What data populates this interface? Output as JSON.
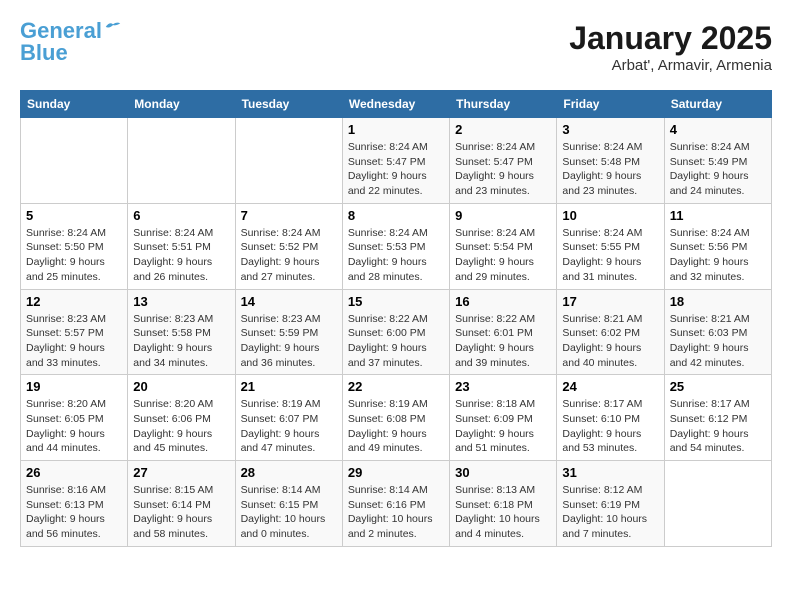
{
  "logo": {
    "line1": "General",
    "line2": "Blue"
  },
  "title": "January 2025",
  "subtitle": "Arbat', Armavir, Armenia",
  "weekdays": [
    "Sunday",
    "Monday",
    "Tuesday",
    "Wednesday",
    "Thursday",
    "Friday",
    "Saturday"
  ],
  "weeks": [
    [
      {
        "day": "",
        "info": ""
      },
      {
        "day": "",
        "info": ""
      },
      {
        "day": "",
        "info": ""
      },
      {
        "day": "1",
        "info": "Sunrise: 8:24 AM\nSunset: 5:47 PM\nDaylight: 9 hours\nand 22 minutes."
      },
      {
        "day": "2",
        "info": "Sunrise: 8:24 AM\nSunset: 5:47 PM\nDaylight: 9 hours\nand 23 minutes."
      },
      {
        "day": "3",
        "info": "Sunrise: 8:24 AM\nSunset: 5:48 PM\nDaylight: 9 hours\nand 23 minutes."
      },
      {
        "day": "4",
        "info": "Sunrise: 8:24 AM\nSunset: 5:49 PM\nDaylight: 9 hours\nand 24 minutes."
      }
    ],
    [
      {
        "day": "5",
        "info": "Sunrise: 8:24 AM\nSunset: 5:50 PM\nDaylight: 9 hours\nand 25 minutes."
      },
      {
        "day": "6",
        "info": "Sunrise: 8:24 AM\nSunset: 5:51 PM\nDaylight: 9 hours\nand 26 minutes."
      },
      {
        "day": "7",
        "info": "Sunrise: 8:24 AM\nSunset: 5:52 PM\nDaylight: 9 hours\nand 27 minutes."
      },
      {
        "day": "8",
        "info": "Sunrise: 8:24 AM\nSunset: 5:53 PM\nDaylight: 9 hours\nand 28 minutes."
      },
      {
        "day": "9",
        "info": "Sunrise: 8:24 AM\nSunset: 5:54 PM\nDaylight: 9 hours\nand 29 minutes."
      },
      {
        "day": "10",
        "info": "Sunrise: 8:24 AM\nSunset: 5:55 PM\nDaylight: 9 hours\nand 31 minutes."
      },
      {
        "day": "11",
        "info": "Sunrise: 8:24 AM\nSunset: 5:56 PM\nDaylight: 9 hours\nand 32 minutes."
      }
    ],
    [
      {
        "day": "12",
        "info": "Sunrise: 8:23 AM\nSunset: 5:57 PM\nDaylight: 9 hours\nand 33 minutes."
      },
      {
        "day": "13",
        "info": "Sunrise: 8:23 AM\nSunset: 5:58 PM\nDaylight: 9 hours\nand 34 minutes."
      },
      {
        "day": "14",
        "info": "Sunrise: 8:23 AM\nSunset: 5:59 PM\nDaylight: 9 hours\nand 36 minutes."
      },
      {
        "day": "15",
        "info": "Sunrise: 8:22 AM\nSunset: 6:00 PM\nDaylight: 9 hours\nand 37 minutes."
      },
      {
        "day": "16",
        "info": "Sunrise: 8:22 AM\nSunset: 6:01 PM\nDaylight: 9 hours\nand 39 minutes."
      },
      {
        "day": "17",
        "info": "Sunrise: 8:21 AM\nSunset: 6:02 PM\nDaylight: 9 hours\nand 40 minutes."
      },
      {
        "day": "18",
        "info": "Sunrise: 8:21 AM\nSunset: 6:03 PM\nDaylight: 9 hours\nand 42 minutes."
      }
    ],
    [
      {
        "day": "19",
        "info": "Sunrise: 8:20 AM\nSunset: 6:05 PM\nDaylight: 9 hours\nand 44 minutes."
      },
      {
        "day": "20",
        "info": "Sunrise: 8:20 AM\nSunset: 6:06 PM\nDaylight: 9 hours\nand 45 minutes."
      },
      {
        "day": "21",
        "info": "Sunrise: 8:19 AM\nSunset: 6:07 PM\nDaylight: 9 hours\nand 47 minutes."
      },
      {
        "day": "22",
        "info": "Sunrise: 8:19 AM\nSunset: 6:08 PM\nDaylight: 9 hours\nand 49 minutes."
      },
      {
        "day": "23",
        "info": "Sunrise: 8:18 AM\nSunset: 6:09 PM\nDaylight: 9 hours\nand 51 minutes."
      },
      {
        "day": "24",
        "info": "Sunrise: 8:17 AM\nSunset: 6:10 PM\nDaylight: 9 hours\nand 53 minutes."
      },
      {
        "day": "25",
        "info": "Sunrise: 8:17 AM\nSunset: 6:12 PM\nDaylight: 9 hours\nand 54 minutes."
      }
    ],
    [
      {
        "day": "26",
        "info": "Sunrise: 8:16 AM\nSunset: 6:13 PM\nDaylight: 9 hours\nand 56 minutes."
      },
      {
        "day": "27",
        "info": "Sunrise: 8:15 AM\nSunset: 6:14 PM\nDaylight: 9 hours\nand 58 minutes."
      },
      {
        "day": "28",
        "info": "Sunrise: 8:14 AM\nSunset: 6:15 PM\nDaylight: 10 hours\nand 0 minutes."
      },
      {
        "day": "29",
        "info": "Sunrise: 8:14 AM\nSunset: 6:16 PM\nDaylight: 10 hours\nand 2 minutes."
      },
      {
        "day": "30",
        "info": "Sunrise: 8:13 AM\nSunset: 6:18 PM\nDaylight: 10 hours\nand 4 minutes."
      },
      {
        "day": "31",
        "info": "Sunrise: 8:12 AM\nSunset: 6:19 PM\nDaylight: 10 hours\nand 7 minutes."
      },
      {
        "day": "",
        "info": ""
      }
    ]
  ]
}
